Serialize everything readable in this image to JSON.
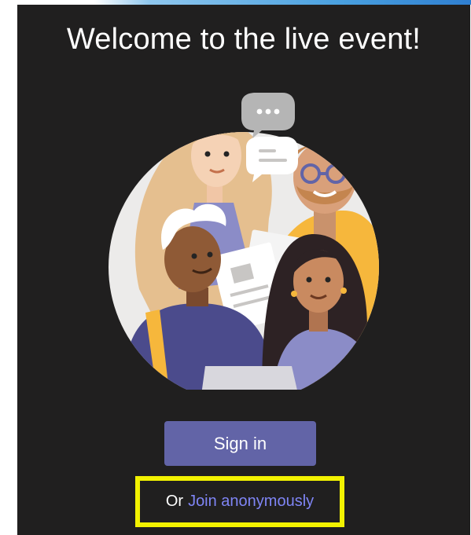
{
  "welcome": {
    "title": "Welcome to the live event!"
  },
  "actions": {
    "sign_in_label": "Sign in",
    "or_text": "Or",
    "join_anonymously_label": "Join anonymously"
  },
  "colors": {
    "background": "#201f1f",
    "button": "#6264a7",
    "link": "#7f85f5",
    "highlight_box": "#f2f200"
  },
  "illustration": {
    "icon": "people-meeting-illustration"
  }
}
